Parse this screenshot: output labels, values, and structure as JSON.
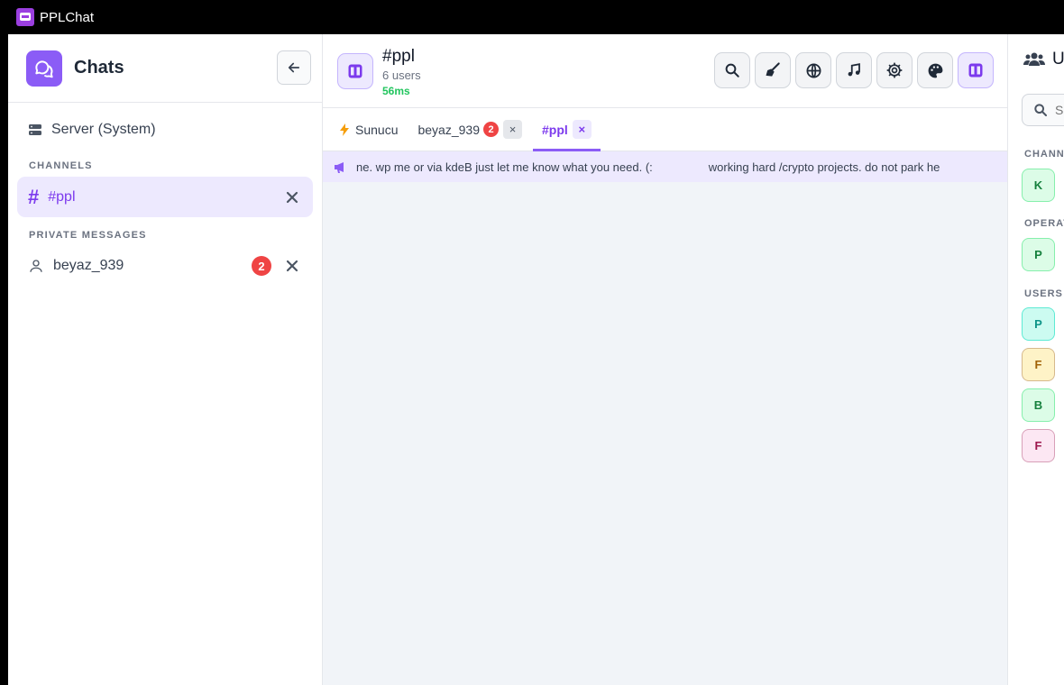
{
  "app": {
    "title": "PPLChat"
  },
  "sidebar": {
    "title": "Chats",
    "server_item": "Server (System)",
    "channels_label": "CHANNELS",
    "channels": [
      {
        "name": "#ppl"
      }
    ],
    "pm_label": "PRIVATE MESSAGES",
    "private_messages": [
      {
        "name": "beyaz_939",
        "unread": "2"
      }
    ]
  },
  "channel": {
    "name": "#ppl",
    "users": "6 users",
    "ping": "56ms"
  },
  "tabs": [
    {
      "label": "Sunucu"
    },
    {
      "label": "beyaz_939",
      "badge": "2",
      "close": "×"
    },
    {
      "label": "#ppl",
      "close": "×"
    }
  ],
  "ticker": {
    "text1": "ne. wp me or via kdeB just let me know what you need. (:",
    "text2": "working hard /crypto projects. do not park he"
  },
  "right_panel": {
    "title": "U",
    "search_placeholder": "S",
    "channel_label": "CHANN",
    "operators_label": "OPERAT",
    "users_label": "USERS",
    "members": [
      {
        "initial": "K",
        "bg": "#dcfce7",
        "border": "#86efac",
        "color": "#15803d"
      },
      {
        "initial": "P",
        "bg": "#dcfce7",
        "border": "#86efac",
        "color": "#15803d"
      },
      {
        "initial": "P",
        "bg": "#ccfbf1",
        "border": "#5eead4",
        "color": "#0d9488"
      },
      {
        "initial": "F",
        "bg": "#fef3c7",
        "border": "#d6b98c",
        "color": "#a16207"
      },
      {
        "initial": "B",
        "bg": "#dcfce7",
        "border": "#86efac",
        "color": "#15803d"
      },
      {
        "initial": "F",
        "bg": "#fce7f3",
        "border": "#d8a0b8",
        "color": "#9d174d"
      }
    ]
  },
  "colors": {
    "accent": "#8b5cf6",
    "badge": "#ef4444",
    "ping": "#22c55e"
  }
}
